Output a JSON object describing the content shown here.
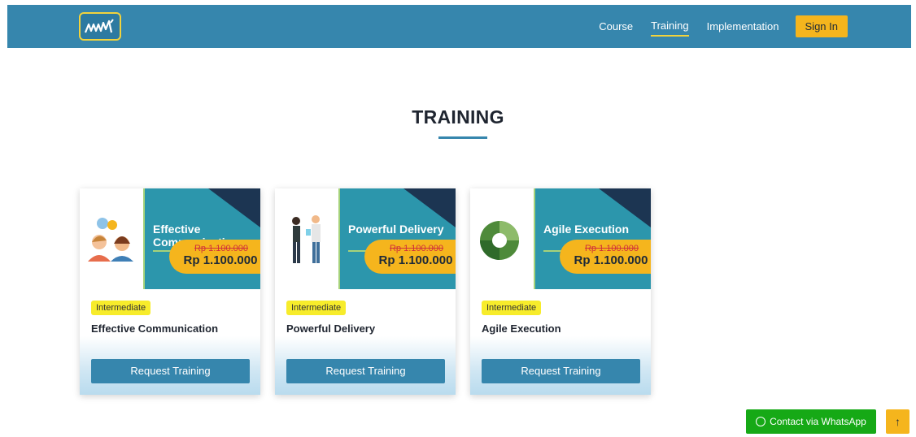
{
  "nav": {
    "logo_icon": "mm-logo-icon",
    "links": [
      {
        "label": "Course"
      },
      {
        "label": "Training"
      },
      {
        "label": "Implementation"
      }
    ],
    "signin_label": "Sign In"
  },
  "section": {
    "title": "TRAINING"
  },
  "cards": [
    {
      "banner_title": "Effective Communication",
      "old_price": "Rp 1.100.000",
      "new_price": "Rp 1.100.000",
      "level": "Intermediate",
      "title": "Effective Communication",
      "button_label": "Request Training",
      "illustration": "people-chat-icon"
    },
    {
      "banner_title": "Powerful Delivery",
      "old_price": "Rp 1.100.000",
      "new_price": "Rp 1.100.000",
      "level": "Intermediate",
      "title": "Powerful Delivery",
      "button_label": "Request Training",
      "illustration": "presenters-icon"
    },
    {
      "banner_title": "Agile Execution",
      "old_price": "Rp 1.100.000",
      "new_price": "Rp 1.100.000",
      "level": "Intermediate",
      "title": "Agile Execution",
      "button_label": "Request Training",
      "illustration": "agile-cycle-icon"
    }
  ],
  "floating": {
    "whatsapp_label": "Contact via WhatsApp",
    "whatsapp_icon": "whatsapp-icon",
    "scroll_top_icon": "arrow-up-icon"
  },
  "colors": {
    "nav_bg": "#3686ad",
    "accent_yellow": "#f5b51d",
    "banner_teal": "#2c96ac",
    "whatsapp_green": "#16a916"
  }
}
